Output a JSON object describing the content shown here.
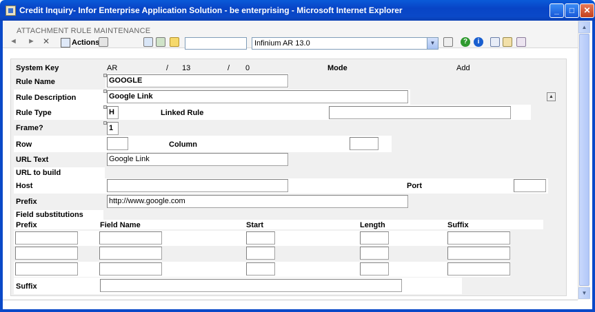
{
  "window": {
    "title": "Credit Inquiry- Infor Enterprise Application Solution - be enterprising - Microsoft Internet Explorer"
  },
  "app": {
    "module_title": "ATTACHMENT RULE MAINTENANCE",
    "nav_back": "◄",
    "nav_forward": "►",
    "nav_close": "✕",
    "actions_label": "Actions",
    "environment": "Infinium AR 13.0",
    "search_value": ""
  },
  "form": {
    "system_key": {
      "label": "System Key",
      "part1": "AR",
      "sep1": "/",
      "part2": "13",
      "sep2": "/",
      "part3": "0"
    },
    "mode": {
      "label": "Mode",
      "value": "Add"
    },
    "rule_name": {
      "label": "Rule Name",
      "value": "GOOGLE"
    },
    "rule_description": {
      "label": "Rule Description",
      "value": "Google Link"
    },
    "rule_type": {
      "label": "Rule Type",
      "value": "H"
    },
    "linked_rule": {
      "label": "Linked Rule",
      "value": ""
    },
    "frame": {
      "label": "Frame?",
      "value": "1"
    },
    "row": {
      "label": "Row",
      "value": ""
    },
    "column": {
      "label": "Column",
      "value": ""
    },
    "url_text": {
      "label": "URL Text",
      "value": "Google Link"
    },
    "url_to_build": {
      "label": "URL to build"
    },
    "host": {
      "label": "Host",
      "value": ""
    },
    "port": {
      "label": "Port",
      "value": ""
    },
    "prefix": {
      "label": "Prefix",
      "value": "http://www.google.com"
    },
    "field_substitutions": {
      "label": "Field substitutions",
      "headers": [
        "Prefix",
        "Field Name",
        "Start",
        "Length",
        "Suffix"
      ],
      "rows": [
        [
          "",
          "",
          "",
          "",
          ""
        ],
        [
          "",
          "",
          "",
          "",
          ""
        ],
        [
          "",
          "",
          "",
          "",
          ""
        ]
      ]
    },
    "suffix": {
      "label": "Suffix",
      "value": ""
    }
  }
}
